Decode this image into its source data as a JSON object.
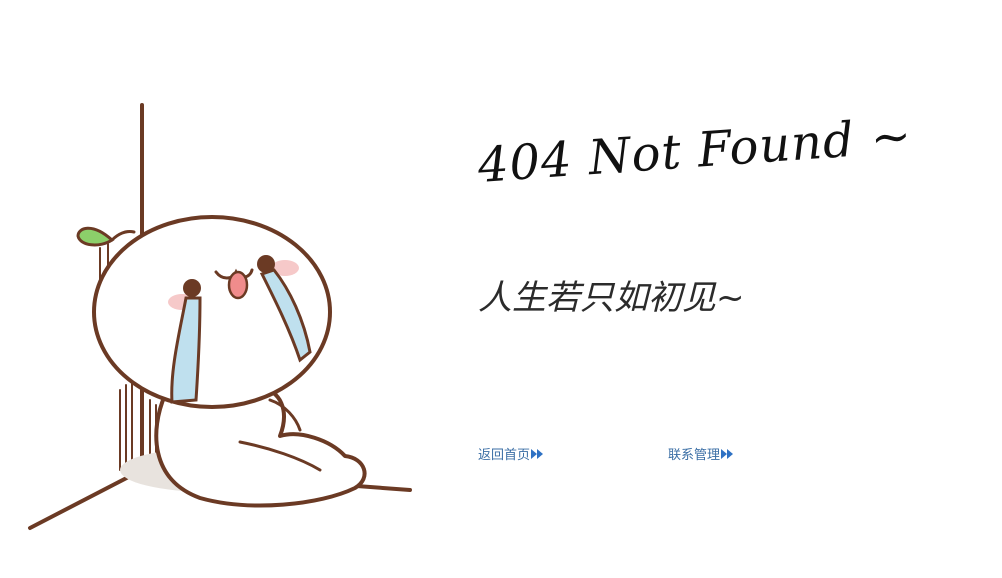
{
  "error": {
    "title": "404 Not Found ~",
    "subtitle": "人生若只如初见~"
  },
  "links": {
    "home": "返回首页",
    "contact": "联系管理"
  },
  "icons": {
    "illustration": "crying-character-illustration",
    "link_arrow": "double-arrow-right-icon"
  },
  "colors": {
    "link": "#3a6ea5",
    "arrow": "#2f72c4",
    "outline": "#6b3a24"
  }
}
